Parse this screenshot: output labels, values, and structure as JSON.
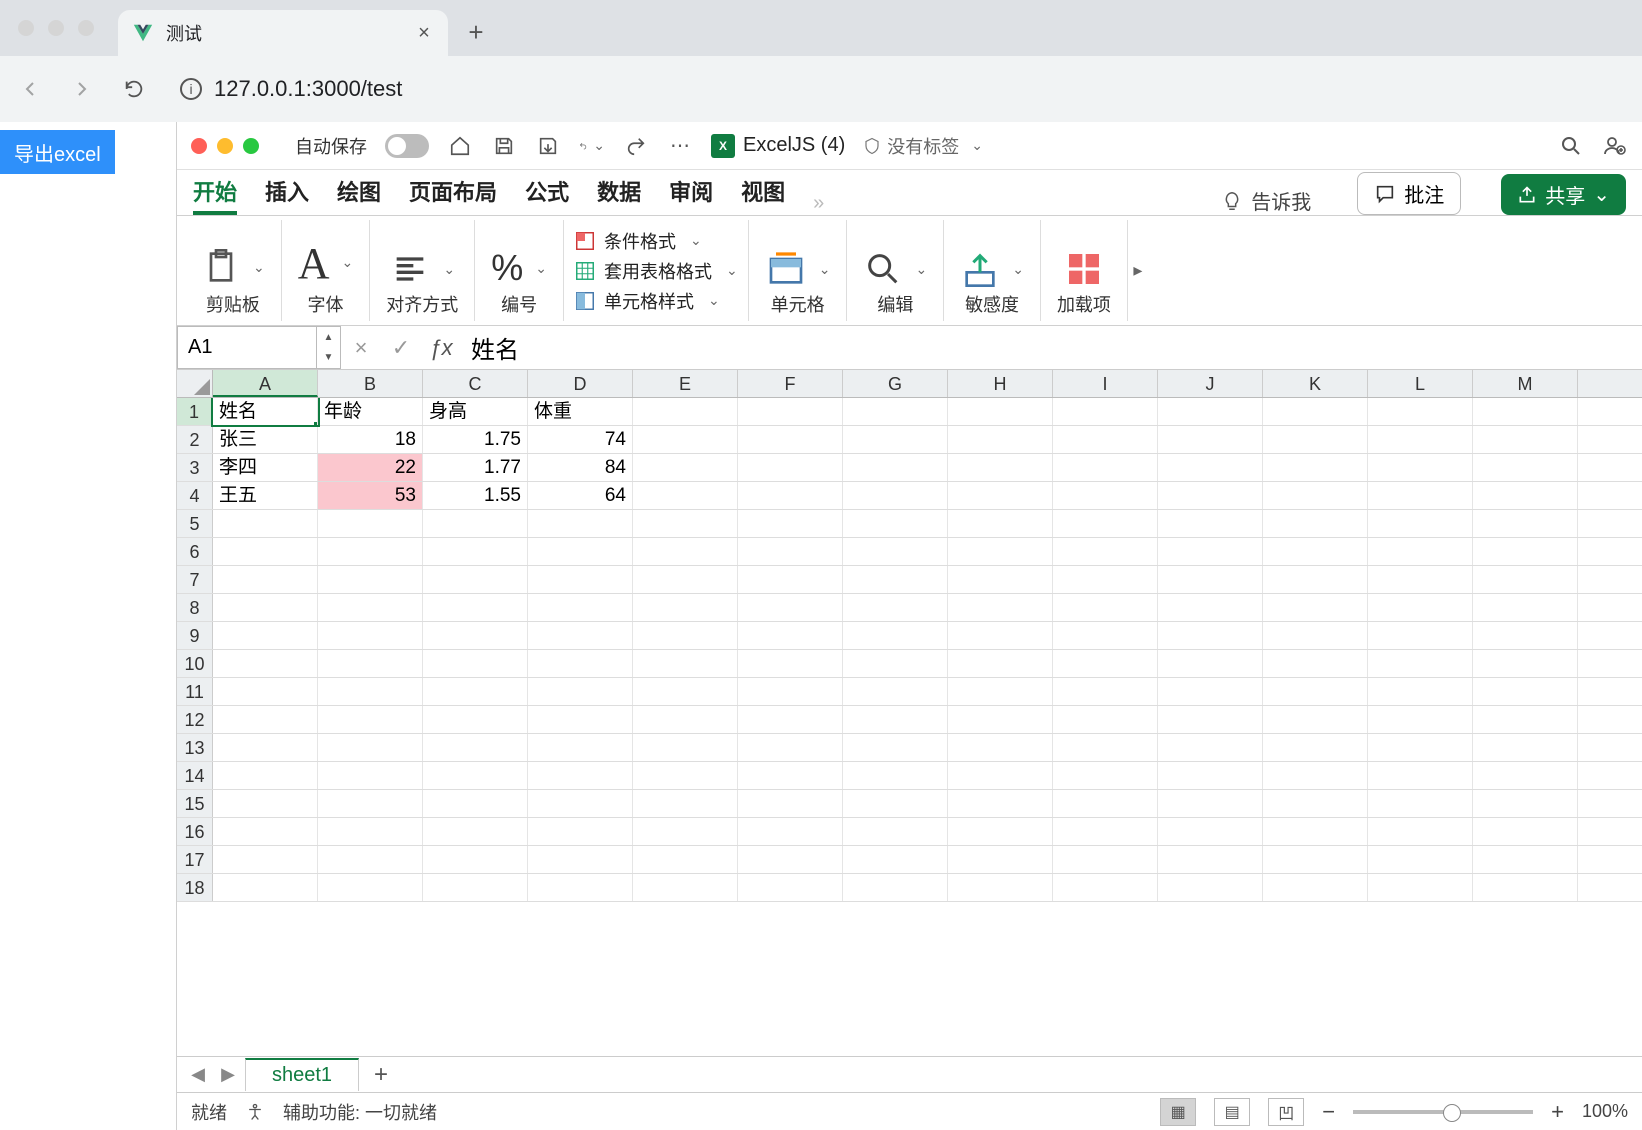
{
  "browser": {
    "tab_title": "测试",
    "url": "127.0.0.1:3000/test"
  },
  "page": {
    "export_button": "导出excel"
  },
  "excel": {
    "autosave_label": "自动保存",
    "file_name": "ExcelJS (4)",
    "tags_label": "没有标签",
    "ribbon_tabs": [
      "开始",
      "插入",
      "绘图",
      "页面布局",
      "公式",
      "数据",
      "审阅",
      "视图"
    ],
    "tell_me": "告诉我",
    "comments_btn": "批注",
    "share_btn": "共享",
    "ribbon_groups": {
      "clipboard": "剪贴板",
      "font": "字体",
      "alignment": "对齐方式",
      "number": "编号",
      "conditional_formatting": "条件格式",
      "format_as_table": "套用表格格式",
      "cell_styles": "单元格样式",
      "cells": "单元格",
      "editing": "编辑",
      "sensitivity": "敏感度",
      "addins": "加载项"
    },
    "name_box": "A1",
    "formula_value": "姓名",
    "columns": [
      "A",
      "B",
      "C",
      "D",
      "E",
      "F",
      "G",
      "H",
      "I",
      "J",
      "K",
      "L",
      "M"
    ],
    "row_count": 18,
    "headers": [
      "姓名",
      "年龄",
      "身高",
      "体重"
    ],
    "data_rows": [
      {
        "name": "张三",
        "age": 18,
        "height": 1.75,
        "weight": 74,
        "highlight": false
      },
      {
        "name": "李四",
        "age": 22,
        "height": 1.77,
        "weight": 84,
        "highlight": true
      },
      {
        "name": "王五",
        "age": 53,
        "height": 1.55,
        "weight": 64,
        "highlight": true
      }
    ],
    "sheet_tab": "sheet1",
    "status_ready": "就绪",
    "status_accessibility": "辅助功能: 一切就绪",
    "zoom": "100%"
  }
}
